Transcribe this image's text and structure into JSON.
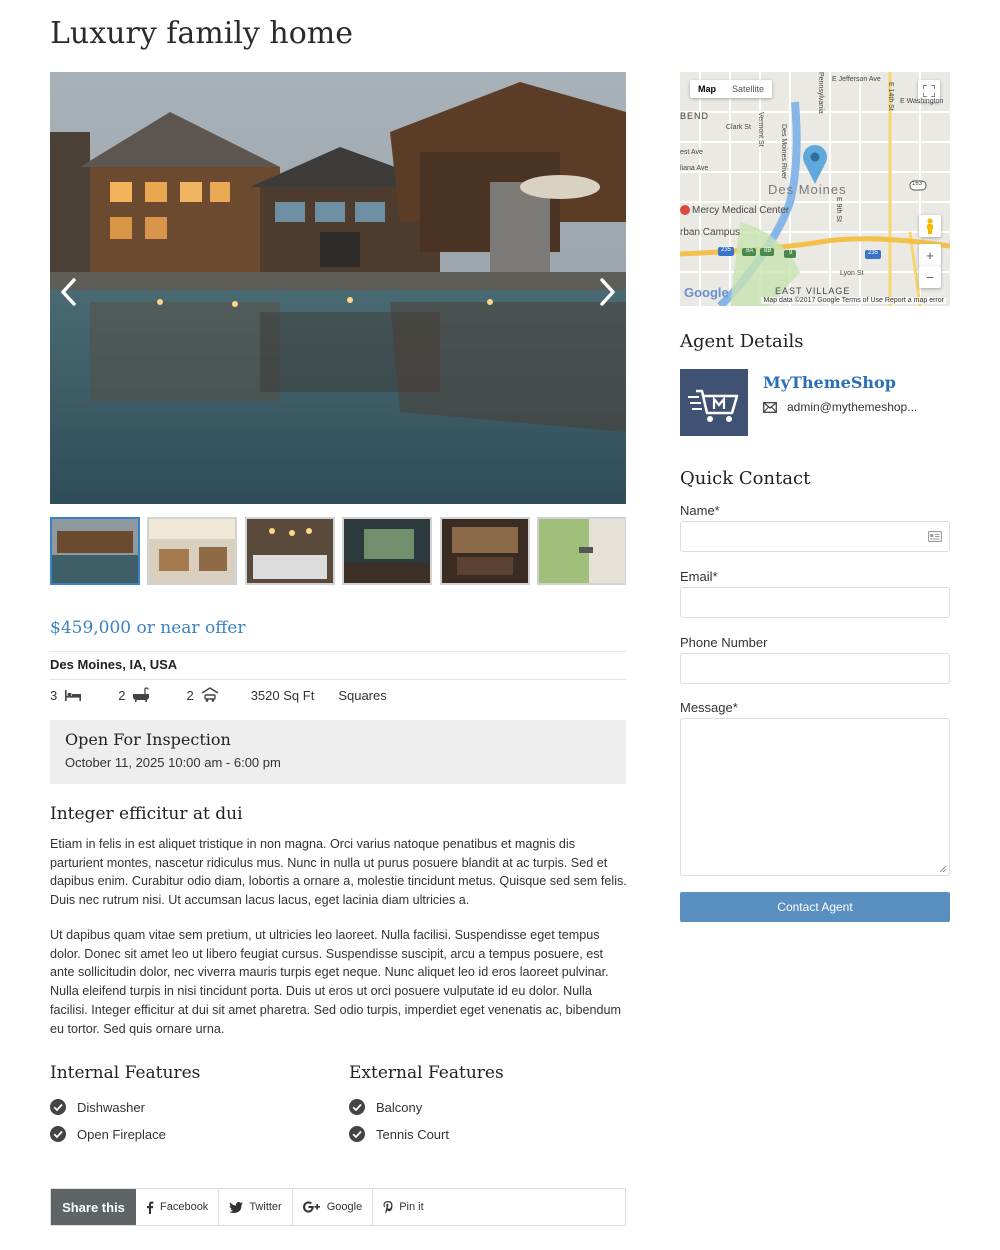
{
  "page": {
    "title": "Luxury family home"
  },
  "gallery": {
    "prev_label": "‹",
    "next_label": "›",
    "thumbnail_count": 6,
    "active_index": 0
  },
  "listing": {
    "price": "$459,000 or near offer",
    "address": "Des Moines, IA, USA",
    "bedrooms": "3",
    "bathrooms": "2",
    "garages": "2",
    "area": "3520 Sq Ft",
    "land": "Squares"
  },
  "inspection": {
    "title": "Open For Inspection",
    "datetime": "October 11, 2025 10:00 am - 6:00 pm"
  },
  "description": {
    "heading": "Integer efficitur at dui",
    "paragraphs": [
      "Etiam in felis in est aliquet tristique in non magna. Orci varius natoque penatibus et magnis dis parturient montes, nascetur ridiculus mus. Nunc in nulla ut purus posuere blandit at ac turpis. Sed et dapibus enim. Curabitur odio diam, lobortis a ornare a, molestie tincidunt metus. Quisque sed sem felis. Duis nec rutrum nisi. Ut accumsan lacus lacus, eget lacinia diam ultricies a.",
      "Ut dapibus quam vitae sem pretium, ut ultricies leo laoreet. Nulla facilisi. Suspendisse eget tempus dolor. Donec sit amet leo ut libero feugiat cursus. Suspendisse suscipit, arcu a tempus posuere, est ante sollicitudin dolor, nec viverra mauris turpis eget neque. Nunc aliquet leo id eros laoreet pulvinar. Nulla eleifend turpis in nisi tincidunt porta. Duis ut eros ut orci posuere vulputate id eu dolor. Nulla facilisi. Integer efficitur at dui sit amet pharetra. Sed odio turpis, imperdiet eget venenatis ac, bibendum eu tortor. Sed quis ornare urna."
    ]
  },
  "features": {
    "internal": {
      "title": "Internal Features",
      "items": [
        "Dishwasher",
        "Open Fireplace"
      ]
    },
    "external": {
      "title": "External Features",
      "items": [
        "Balcony",
        "Tennis Court"
      ]
    }
  },
  "share": {
    "label": "Share this",
    "buttons": [
      {
        "label": "Facebook",
        "icon": "facebook-icon"
      },
      {
        "label": "Twitter",
        "icon": "twitter-icon"
      },
      {
        "label": "Google",
        "icon": "google-plus-icon"
      },
      {
        "label": "Pin it",
        "icon": "pinterest-icon"
      }
    ]
  },
  "map": {
    "tab_map": "Map",
    "tab_satellite": "Satellite",
    "zoom_in": "+",
    "zoom_out": "−",
    "fullscreen_icon": "fullscreen-icon",
    "labels": {
      "city": "Des Moines",
      "hospital": "Mercy Medical Center",
      "campus": "rban Campus",
      "district": "EAST VILLAGE",
      "bend": "BEND",
      "river": "Des Moines River",
      "clark": "Clark St",
      "jefferson": "E Jefferson Ave",
      "washington": "E Washington",
      "fourteenth": "E 14th St",
      "ninth": "E 9th St",
      "lyon": "Lyon St",
      "vermont": "Vermont St",
      "pennsylvania": "Pennsylvania",
      "west1": "est Ave",
      "west2": "liana Ave",
      "hwy163": "163",
      "hwy235a": "235",
      "hwy235b": "235",
      "hwy8a": "8A",
      "hwy8b": "8B",
      "hwy9": "9"
    },
    "google": "Google",
    "footer": "Map data ©2017 Google   Terms of Use   Report a map error"
  },
  "agent": {
    "heading": "Agent Details",
    "name": "MyThemeShop",
    "email": "admin@mythemeshop..."
  },
  "contact": {
    "heading": "Quick Contact",
    "name_label": "Name*",
    "email_label": "Email*",
    "phone_label": "Phone Number",
    "message_label": "Message*",
    "submit_label": "Contact Agent"
  },
  "colors": {
    "accent": "#3b82c4",
    "agent_link": "#2a6fb5",
    "button": "#5a8fc2",
    "share_label_bg": "#5f6466"
  }
}
